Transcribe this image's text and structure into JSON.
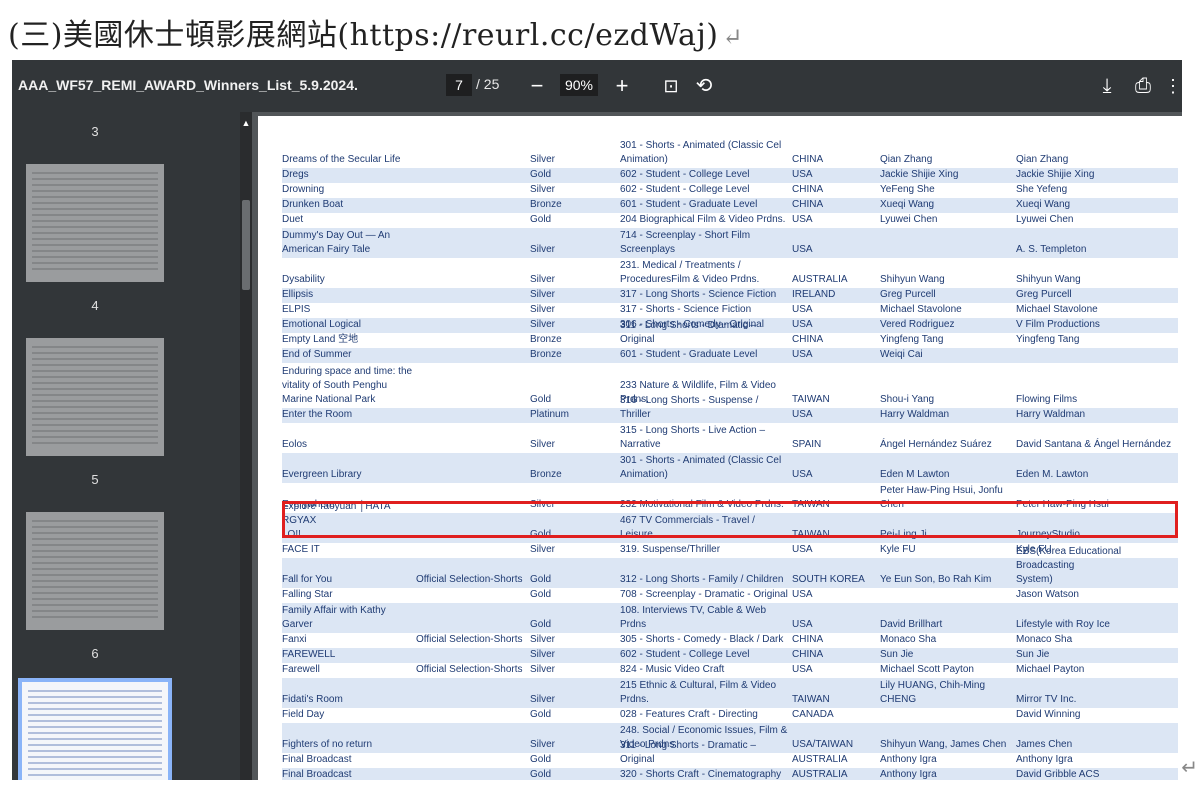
{
  "heading": {
    "text": "(三)美國休士頓影展網站(https://reurl.cc/ezdWaj)",
    "return_mark": "↵"
  },
  "viewer": {
    "filename": "AAA_WF57_REMI_AWARD_Winners_List_5.9.2024.",
    "page_current": "7",
    "page_total": "/ 25",
    "zoom": "90%",
    "icons": {
      "zoom_out": "−",
      "zoom_in": "+",
      "fit": "⊡",
      "rotate": "⟲",
      "download": "⤓",
      "print": "⎙",
      "more": "⋮"
    }
  },
  "thumbnails": [
    {
      "label": "3",
      "active": false
    },
    {
      "label": "4",
      "active": false
    },
    {
      "label": "5",
      "active": false
    },
    {
      "label": "6",
      "active": false
    },
    {
      "label": "7",
      "active": true
    }
  ],
  "table_rows": [
    [
      [
        "Dreams of the Secular Life"
      ],
      [
        ""
      ],
      [
        "Silver"
      ],
      [
        "301 - Shorts - Animated (Classic Cel",
        "Animation)"
      ],
      [
        "CHINA"
      ],
      [
        "Qian Zhang"
      ],
      [
        "Qian Zhang"
      ]
    ],
    [
      [
        "Dregs"
      ],
      [
        ""
      ],
      [
        "Gold"
      ],
      [
        "602 - Student - College Level"
      ],
      [
        "USA"
      ],
      [
        "Jackie Shijie Xing"
      ],
      [
        "Jackie Shijie Xing"
      ]
    ],
    [
      [
        "Drowning"
      ],
      [
        ""
      ],
      [
        "Silver"
      ],
      [
        "602 - Student - College Level"
      ],
      [
        "CHINA"
      ],
      [
        "YeFeng She"
      ],
      [
        "She Yefeng"
      ]
    ],
    [
      [
        "Drunken Boat"
      ],
      [
        ""
      ],
      [
        "Bronze"
      ],
      [
        "601 - Student - Graduate Level"
      ],
      [
        "CHINA"
      ],
      [
        "Xueqi Wang"
      ],
      [
        "Xueqi Wang"
      ]
    ],
    [
      [
        "Duet"
      ],
      [
        ""
      ],
      [
        "Gold"
      ],
      [
        "204 Biographical Film & Video Prdns."
      ],
      [
        "USA"
      ],
      [
        "Lyuwei Chen"
      ],
      [
        "Lyuwei Chen"
      ]
    ],
    [
      [
        "Dummy's Day Out — An",
        "American Fairy Tale"
      ],
      [
        ""
      ],
      [
        "Silver"
      ],
      [
        "714 - Screenplay - Short Film",
        "Screenplays"
      ],
      [
        "USA"
      ],
      [
        ""
      ],
      [
        "A. S. Templeton"
      ]
    ],
    [
      [
        "Dysability"
      ],
      [
        ""
      ],
      [
        "Silver"
      ],
      [
        "231. Medical / Treatments /",
        "ProceduresFilm & Video Prdns."
      ],
      [
        "AUSTRALIA"
      ],
      [
        "Shihyun Wang"
      ],
      [
        "Shihyun Wang"
      ]
    ],
    [
      [
        "Ellipsis"
      ],
      [
        ""
      ],
      [
        "Silver"
      ],
      [
        "317 - Long Shorts - Science Fiction"
      ],
      [
        "IRELAND"
      ],
      [
        "Greg Purcell"
      ],
      [
        "Greg Purcell"
      ]
    ],
    [
      [
        "ELPIS"
      ],
      [
        ""
      ],
      [
        "Silver"
      ],
      [
        "317 - Shorts - Science Fiction"
      ],
      [
        "USA"
      ],
      [
        "Michael Stavolone"
      ],
      [
        "Michael Stavolone"
      ]
    ],
    [
      [
        "Emotional Logical"
      ],
      [
        ""
      ],
      [
        "Silver"
      ],
      [
        "306 - Shorts - Comedy - Original"
      ],
      [
        "USA"
      ],
      [
        "Vered Rodriguez"
      ],
      [
        "V Film Productions"
      ]
    ],
    [
      [
        "Empty Land 空地"
      ],
      [
        ""
      ],
      [
        "Bronze"
      ],
      [
        "311 - Long Shorts - Dramatic – Original"
      ],
      [
        "CHINA"
      ],
      [
        "Yingfeng Tang"
      ],
      [
        "Yingfeng Tang"
      ]
    ],
    [
      [
        "End of Summer"
      ],
      [
        ""
      ],
      [
        "Bronze"
      ],
      [
        "601 - Student - Graduate Level"
      ],
      [
        "USA"
      ],
      [
        "Weiqi Cai"
      ],
      [
        ""
      ]
    ],
    [
      [
        "Enduring space and time: the",
        "vitality of South Penghu",
        "Marine National Park"
      ],
      [
        ""
      ],
      [
        "Gold"
      ],
      [
        "233 Nature & Wildlife, Film & Video",
        "Prdns."
      ],
      [
        "TAIWAN"
      ],
      [
        "Shou-i Yang"
      ],
      [
        "Flowing Films"
      ]
    ],
    [
      [
        "Enter the Room"
      ],
      [
        ""
      ],
      [
        "Platinum"
      ],
      [
        "316 - Long Shorts - Suspense / Thriller"
      ],
      [
        "USA"
      ],
      [
        "Harry Waldman"
      ],
      [
        "Harry Waldman"
      ]
    ],
    [
      [
        "Eolos"
      ],
      [
        ""
      ],
      [
        "Silver"
      ],
      [
        "315 - Long Shorts - Live Action –",
        "Narrative"
      ],
      [
        "SPAIN"
      ],
      [
        "Ángel Hernández Suárez"
      ],
      [
        "David Santana & Ángel Hernández"
      ]
    ],
    [
      [
        "Evergreen Library"
      ],
      [
        ""
      ],
      [
        "Bronze"
      ],
      [
        "301 - Shorts - Animated (Classic Cel",
        "Animation)"
      ],
      [
        "USA"
      ],
      [
        "Eden M Lawton"
      ],
      [
        "Eden M. Lawton"
      ]
    ],
    [
      [
        "Everywhere"
      ],
      [
        ""
      ],
      [
        "Silver"
      ],
      [
        "232 Motivational Film & Video Prdns."
      ],
      [
        "TAIWAN"
      ],
      [
        "Peter Haw-Ping Hsui, Jonfu",
        "Chen"
      ],
      [
        "Peter Haw-Ping Hsui"
      ]
    ],
    [
      [
        "Explore Taoyuan │HATA RGYAX",
        "LO!!"
      ],
      [
        ""
      ],
      [
        "Gold"
      ],
      [
        "467 TV Commercials - Travel / Leisure"
      ],
      [
        "TAIWAN"
      ],
      [
        "Pei-Ling Ji"
      ],
      [
        "JourneyStudio"
      ]
    ],
    [
      [
        "FACE IT"
      ],
      [
        ""
      ],
      [
        "Silver"
      ],
      [
        "319. Suspense/Thriller"
      ],
      [
        "USA"
      ],
      [
        "Kyle FU"
      ],
      [
        "Kyle FU"
      ]
    ],
    [
      [
        "Fall for You"
      ],
      [
        "Official Selection-Shorts"
      ],
      [
        "Gold"
      ],
      [
        "312 - Long Shorts - Family / Children"
      ],
      [
        "SOUTH KOREA"
      ],
      [
        "Ye Eun Son, Bo Rah Kim"
      ],
      [
        "EBS(Korea Educational Broadcasting",
        "System)"
      ]
    ],
    [
      [
        "Falling Star"
      ],
      [
        ""
      ],
      [
        "Gold"
      ],
      [
        "708 - Screenplay - Dramatic - Original"
      ],
      [
        "USA"
      ],
      [
        ""
      ],
      [
        "Jason Watson"
      ]
    ],
    [
      [
        "Family Affair with Kathy",
        "Garver"
      ],
      [
        ""
      ],
      [
        "Gold"
      ],
      [
        "108. Interviews TV, Cable & Web Prdns"
      ],
      [
        "USA"
      ],
      [
        "David Brillhart"
      ],
      [
        "Lifestyle with Roy Ice"
      ]
    ],
    [
      [
        "Fanxi"
      ],
      [
        "Official Selection-Shorts"
      ],
      [
        "Silver"
      ],
      [
        "305 - Shorts - Comedy - Black / Dark"
      ],
      [
        "CHINA"
      ],
      [
        "Monaco Sha"
      ],
      [
        "Monaco Sha"
      ]
    ],
    [
      [
        "FAREWELL"
      ],
      [
        ""
      ],
      [
        "Silver"
      ],
      [
        "602 - Student - College Level"
      ],
      [
        "CHINA"
      ],
      [
        "Sun Jie"
      ],
      [
        "Sun Jie"
      ]
    ],
    [
      [
        "Farewell"
      ],
      [
        "Official Selection-Shorts"
      ],
      [
        "Silver"
      ],
      [
        "824 - Music Video Craft"
      ],
      [
        "USA"
      ],
      [
        "Michael Scott Payton"
      ],
      [
        "Michael Payton"
      ]
    ],
    [
      [
        "Fidati's Room"
      ],
      [
        ""
      ],
      [
        "Silver"
      ],
      [
        "215 Ethnic & Cultural, Film & Video",
        "Prdns."
      ],
      [
        "TAIWAN"
      ],
      [
        "Lily HUANG, Chih-Ming CHENG"
      ],
      [
        "Mirror TV Inc."
      ]
    ],
    [
      [
        "Field Day"
      ],
      [
        ""
      ],
      [
        "Gold"
      ],
      [
        "028 - Features Craft - Directing"
      ],
      [
        "CANADA"
      ],
      [
        ""
      ],
      [
        "David Winning"
      ]
    ],
    [
      [
        "Fighters of no return"
      ],
      [
        ""
      ],
      [
        "Silver"
      ],
      [
        "248. Social / Economic Issues, Film &",
        "Video Prdns."
      ],
      [
        "USA/TAIWAN"
      ],
      [
        "Shihyun Wang, James Chen"
      ],
      [
        "James Chen"
      ]
    ],
    [
      [
        "Final Broadcast"
      ],
      [
        ""
      ],
      [
        "Gold"
      ],
      [
        "311 - Long Shorts - Dramatic – Original"
      ],
      [
        "AUSTRALIA"
      ],
      [
        "Anthony Igra"
      ],
      [
        "Anthony Igra"
      ]
    ],
    [
      [
        "Final Broadcast"
      ],
      [
        ""
      ],
      [
        "Gold"
      ],
      [
        "320 - Shorts Craft - Cinematography"
      ],
      [
        "AUSTRALIA"
      ],
      [
        "Anthony Igra"
      ],
      [
        "David Gribble ACS"
      ]
    ]
  ],
  "colors": {
    "accent_highlight": "#e01f1f",
    "row_shade": "#dce6f4",
    "text": "#1f3b73"
  }
}
